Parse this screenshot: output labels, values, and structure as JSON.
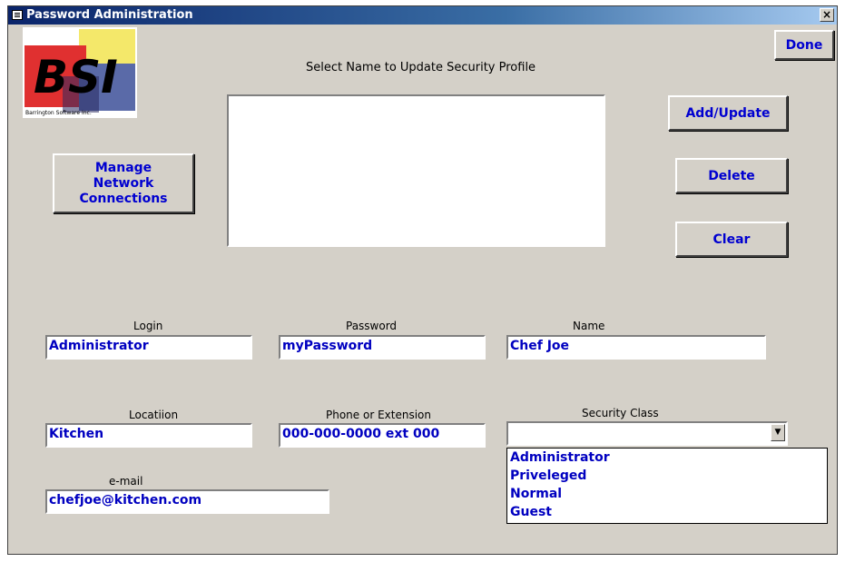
{
  "window": {
    "title": "Password Administration",
    "close_label": "×"
  },
  "logo": {
    "text": "BSI",
    "company": "Barrington Software Inc."
  },
  "header": {
    "instruction": "Select Name to Update Security Profile"
  },
  "buttons": {
    "done": "Done",
    "add_update": "Add/Update",
    "delete": "Delete",
    "clear": "Clear",
    "manage_network": "Manage Network Connections"
  },
  "form": {
    "login": {
      "label": "Login",
      "value": "Administrator"
    },
    "password": {
      "label": "Password",
      "value": "myPassword"
    },
    "name": {
      "label": "Name",
      "value": "Chef Joe"
    },
    "location": {
      "label": "Locatiion",
      "value": "Kitchen"
    },
    "phone": {
      "label": "Phone or Extension",
      "value": "000-000-0000 ext 000"
    },
    "security_class": {
      "label": "Security Class",
      "value": "",
      "options": [
        "Administrator",
        "Priveleged",
        "Normal",
        "Guest"
      ]
    },
    "email": {
      "label": "e-mail",
      "value": "chefjoe@kitchen.com"
    }
  }
}
